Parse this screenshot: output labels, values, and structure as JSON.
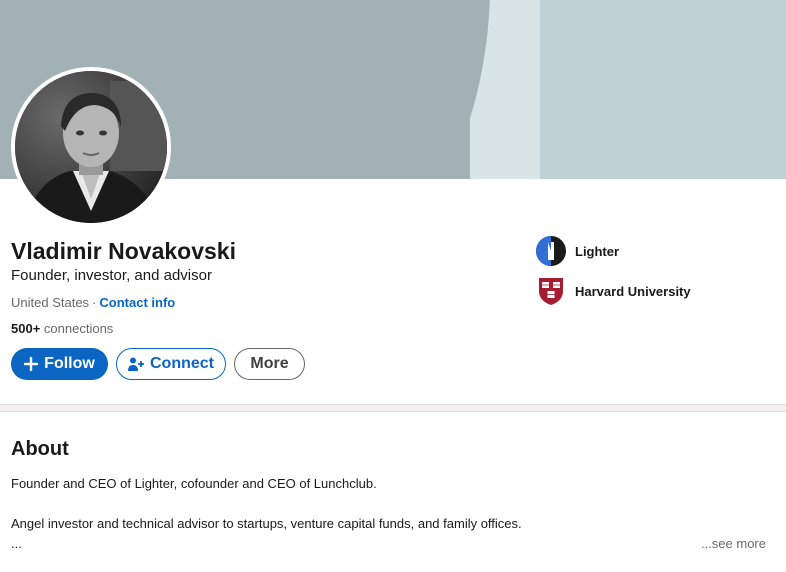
{
  "profile": {
    "name": "Vladimir Novakovski",
    "headline": "Founder, investor, and advisor",
    "location": "United States",
    "separator": "·",
    "contact_info": "Contact info",
    "connections_count": "500+",
    "connections_label": "connections"
  },
  "actions": {
    "follow_label": "Follow",
    "connect_label": "Connect",
    "more_label": "More"
  },
  "organizations": [
    {
      "name": "Lighter",
      "logo_icon": "lighter-logo-icon"
    },
    {
      "name": "Harvard University",
      "logo_icon": "harvard-shield-icon"
    }
  ],
  "about": {
    "title": "About",
    "line1": "Founder and CEO of Lighter, cofounder and CEO of Lunchclub.",
    "line2": "Angel investor and technical advisor to startups, venture capital funds, and family offices.",
    "ellipsis": "...",
    "see_more": "...see more"
  },
  "colors": {
    "primary_blue": "#0a66c2",
    "banner_gray": "#a2b1b5",
    "harvard_crimson": "#a51c30"
  }
}
